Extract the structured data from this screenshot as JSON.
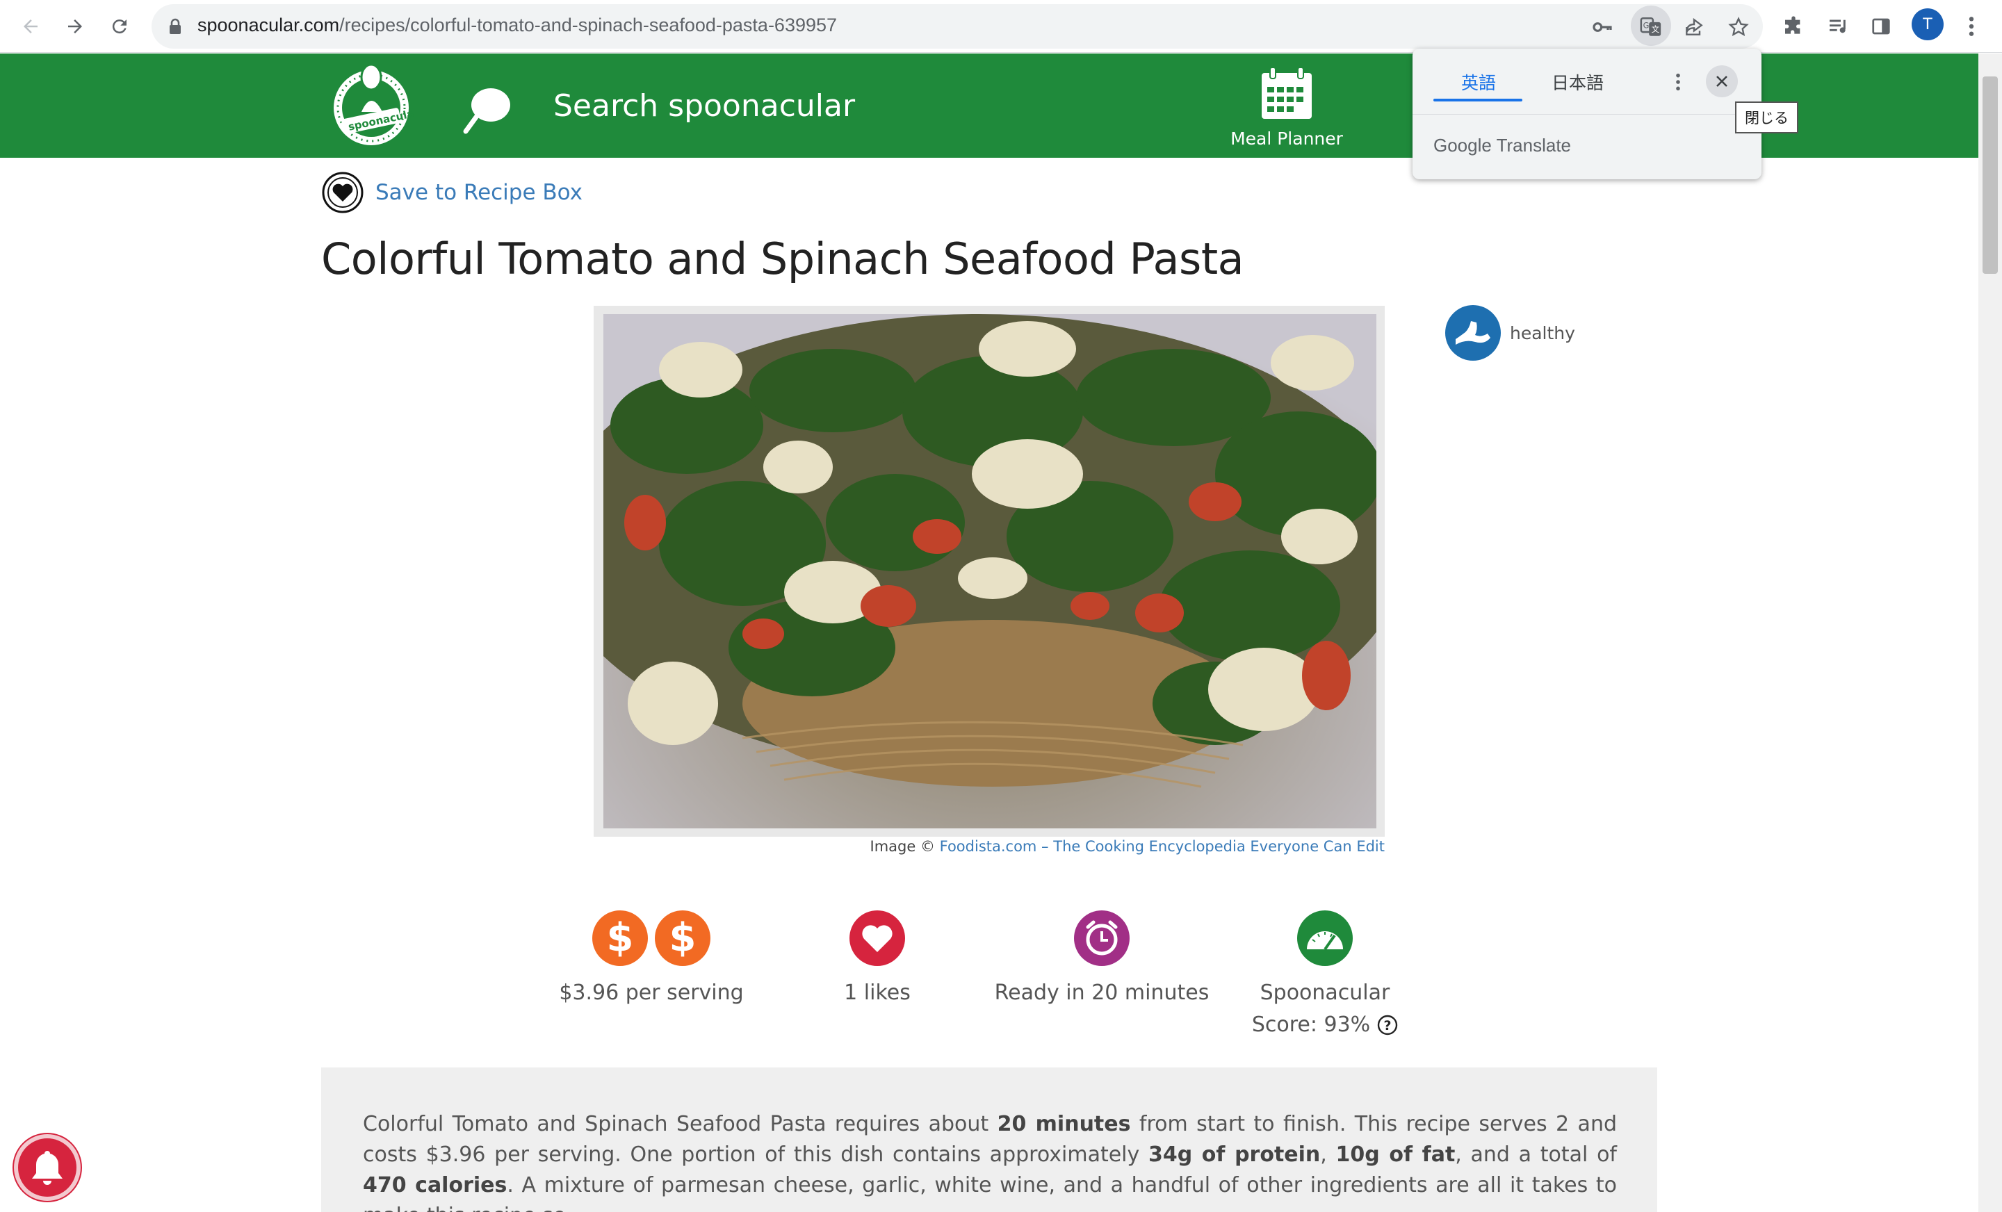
{
  "browser": {
    "url_host": "spoonacular.com",
    "url_path": "/recipes/colorful-tomato-and-spinach-seafood-pasta-639957",
    "profile_initial": "T"
  },
  "header": {
    "search_placeholder": "Search spoonacular",
    "meal_planner_label": "Meal Planner",
    "logo_text": "spoonacular"
  },
  "translate_popup": {
    "tab_source": "英語",
    "tab_target": "日本語",
    "brand": "Google Translate",
    "close_tooltip": "閉じる"
  },
  "recipe": {
    "save_label": "Save to Recipe Box",
    "title": "Colorful Tomato and Spinach Seafood Pasta",
    "image_credit_prefix": "Image © ",
    "image_credit_link": "Foodista.com – The Cooking Encyclopedia Everyone Can Edit",
    "badge": "healthy"
  },
  "stats": {
    "price": "$3.96 per serving",
    "likes": "1 likes",
    "ready": "Ready in 20 minutes",
    "score_line1": "Spoonacular",
    "score_line2": "Score: 93%"
  },
  "summary": {
    "t1": "Colorful Tomato and Spinach Seafood Pasta requires about ",
    "b1": "20 minutes",
    "t2": " from start to finish. This recipe serves 2 and costs $3.96 per serving. One portion of this dish contains approximately ",
    "b2": "34g of protein",
    "t3": ", ",
    "b3": "10g of fat",
    "t4": ", and a total of ",
    "b4": "470 calories",
    "t5": ". A mixture of parmesan cheese, garlic, white wine, and a handful of other ingredients are all it takes to make this recipe so"
  },
  "colors": {
    "header_green": "#1f8a3b",
    "link_blue": "#3a7bb8",
    "price_orange": "#f26a23",
    "likes_red": "#d6243e",
    "time_purple": "#a12f86",
    "score_green": "#1f8a3b",
    "badge_blue": "#1e6fb0"
  }
}
